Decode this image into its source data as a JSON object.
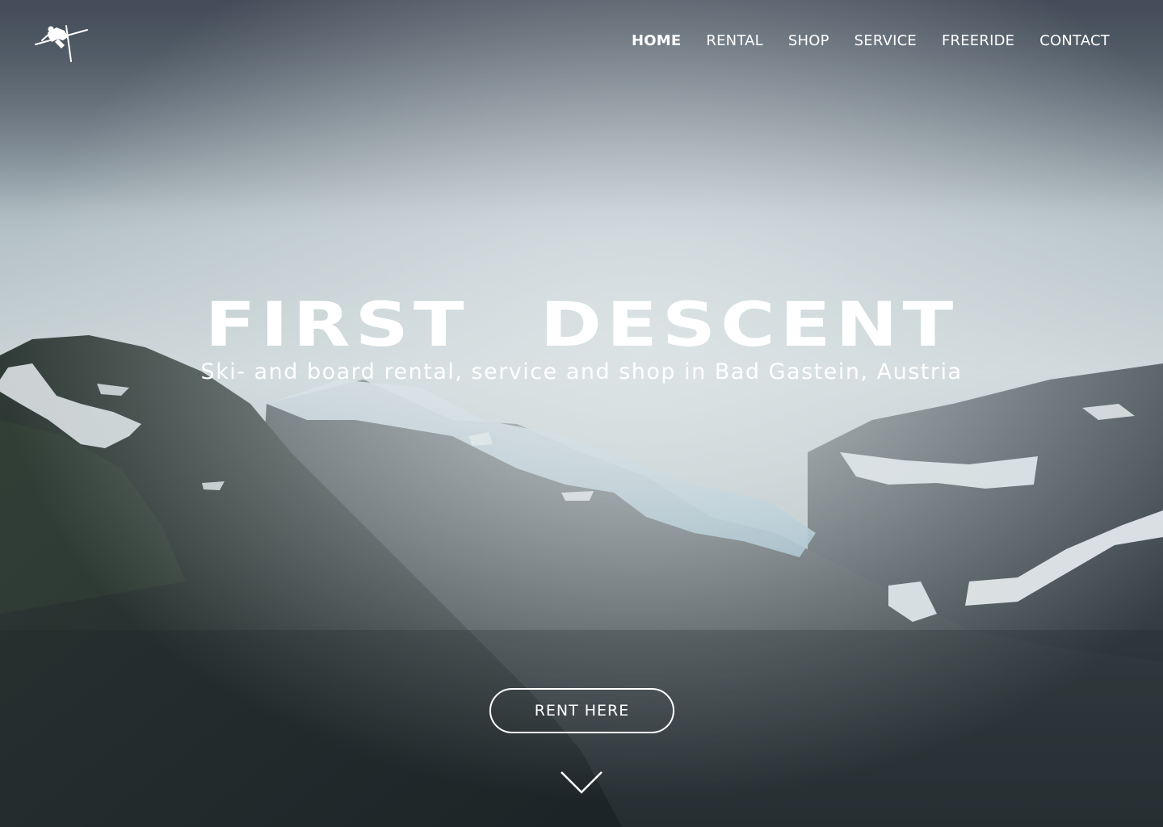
{
  "brand": {
    "logo_icon": "skier-jump-icon"
  },
  "nav": {
    "items": [
      {
        "label": "HOME",
        "active": true
      },
      {
        "label": "RENTAL",
        "active": false
      },
      {
        "label": "SHOP",
        "active": false
      },
      {
        "label": "SERVICE",
        "active": false
      },
      {
        "label": "FREERIDE",
        "active": false
      },
      {
        "label": "CONTACT",
        "active": false
      }
    ]
  },
  "hero": {
    "title": "FIRST DESCENT",
    "subtitle": "Ski- and board rental, service and shop in Bad Gastein, Austria",
    "cta_label": "RENT HERE",
    "scroll_icon": "chevron-down-icon"
  },
  "colors": {
    "text": "#ffffff",
    "sky": "#c7d2d5",
    "mountain": "#2c3439",
    "glacier": "#8fb3c4"
  }
}
